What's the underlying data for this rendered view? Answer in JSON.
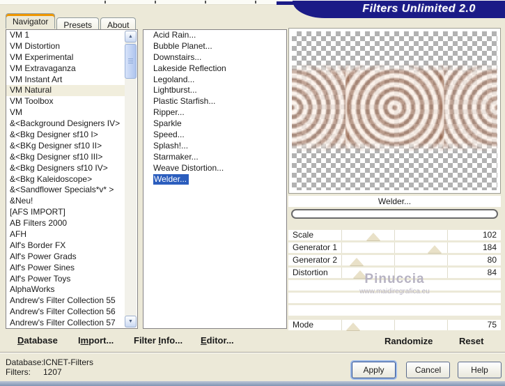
{
  "title": "Filters Unlimited 2.0",
  "tabs": [
    {
      "label": "Navigator",
      "active": true
    },
    {
      "label": "Presets",
      "active": false
    },
    {
      "label": "About",
      "active": false
    }
  ],
  "left_list": {
    "selected_index": 5,
    "items": [
      "VM 1",
      "VM Distortion",
      "VM Experimental",
      "VM Extravaganza",
      "VM Instant Art",
      "VM Natural",
      "VM Toolbox",
      "VM",
      "&<Background Designers IV>",
      "&<Bkg Designer sf10 I>",
      "&<BKg Designer sf10 II>",
      "&<Bkg Designer sf10 III>",
      "&<Bkg Designers sf10 IV>",
      "&<Bkg Kaleidoscope>",
      "&<Sandflower Specials*v* >",
      "&Neu!",
      "[AFS IMPORT]",
      "AB Filters 2000",
      "AFH",
      "Alf's Border FX",
      "Alf's Power Grads",
      "Alf's Power Sines",
      "Alf's Power Toys",
      "AlphaWorks",
      "Andrew's Filter Collection 55",
      "Andrew's Filter Collection 56",
      "Andrew's Filter Collection 57"
    ]
  },
  "middle_list": {
    "selected_index": 13,
    "items": [
      "Acid Rain...",
      "Bubble Planet...",
      "Downstairs...",
      "Lakeside Reflection",
      "Legoland...",
      "Lightburst...",
      "Plastic Starfish...",
      "Ripper...",
      "Sparkle",
      "Speed...",
      "Splash!...",
      "Starmaker...",
      "Weave Distortion...",
      "Welder..."
    ]
  },
  "preview": {
    "filter_name": "Welder..."
  },
  "sliders": {
    "max": 255,
    "rows": [
      {
        "label": "Scale",
        "value": 102
      },
      {
        "label": "Generator 1",
        "value": 184
      },
      {
        "label": "Generator 2",
        "value": 80
      },
      {
        "label": "Distortion",
        "value": 84
      },
      {
        "label": "",
        "value": null
      },
      {
        "label": "",
        "value": null
      },
      {
        "label": "",
        "value": null
      },
      {
        "label": "Mode",
        "value": 75,
        "gap_before": true
      }
    ]
  },
  "watermark": {
    "line1": "Pinuccia",
    "line2": "www.maidiregrafica.eu"
  },
  "panel_buttons": {
    "randomize": "Randomize",
    "reset": "Reset"
  },
  "menu": {
    "items": [
      {
        "pre": "",
        "key": "D",
        "post": "atabase"
      },
      {
        "pre": "I",
        "key": "m",
        "post": "port..."
      },
      {
        "pre": "Filter ",
        "key": "I",
        "post": "nfo..."
      },
      {
        "pre": "",
        "key": "E",
        "post": "ditor..."
      }
    ]
  },
  "status": {
    "database_label": "Database:",
    "database_value": "ICNET-Filters",
    "filters_label": "Filters:",
    "filters_value": "1207"
  },
  "action_buttons": {
    "apply": "Apply",
    "cancel": "Cancel",
    "help": "Help"
  },
  "colors": {
    "dialog_bg": "#ece9d8",
    "banner": "#1b1b87",
    "selection_blue": "#2b5dbd",
    "selection_pale": "#f1eedd",
    "tab_accent": "#ef9700",
    "thumb": "#e9e1c8",
    "watermark": "#b7b3c3",
    "ring_dark": "#8d5a40",
    "ring_light": "#faeee5"
  }
}
